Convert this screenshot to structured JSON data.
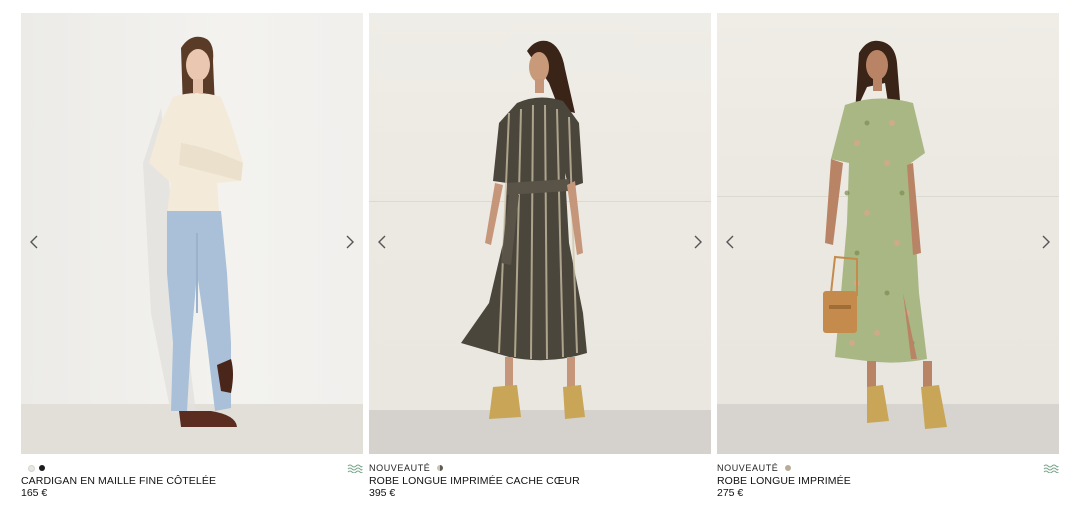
{
  "products": [
    {
      "badge": "",
      "title": "CARDIGAN EN MAILLE FINE CÔTELÉE",
      "price": "165 €",
      "colors": [
        "#e8e6e1",
        "#1c1c1c"
      ],
      "selected_color_index": 1,
      "eco_icon": "wave-eco-icon"
    },
    {
      "badge": "NOUVEAUTÉ",
      "title": "ROBE LONGUE IMPRIMÉE CACHE CŒUR",
      "price": "395 €",
      "colors": [
        "#5e5a52"
      ],
      "selected_color_index": 0,
      "eco_icon": ""
    },
    {
      "badge": "NOUVEAUTÉ",
      "title": "ROBE LONGUE IMPRIMÉE",
      "price": "275 €",
      "colors": [
        "#b9ac97"
      ],
      "selected_color_index": 0,
      "eco_icon": "wave-eco-icon"
    }
  ],
  "accent_color": "#111111",
  "eco_color": "#7aa58c"
}
